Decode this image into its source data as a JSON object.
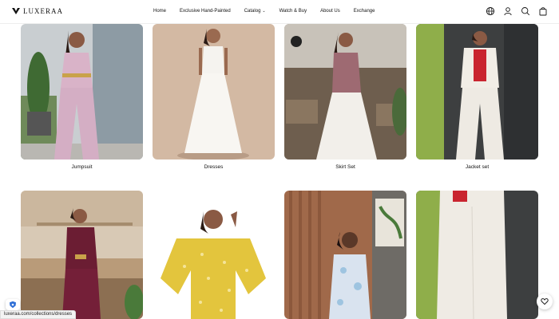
{
  "brand": {
    "name": "LUXERAA"
  },
  "nav": {
    "items": [
      {
        "label": "Home"
      },
      {
        "label": "Exclusive Hand-Painted"
      },
      {
        "label": "Catalog"
      },
      {
        "label": "Watch & Buy"
      },
      {
        "label": "About Us"
      },
      {
        "label": "Exchange"
      }
    ],
    "catalog_chevron": "⌄"
  },
  "header_icons": [
    "globe-icon",
    "account-icon",
    "search-icon",
    "bag-icon"
  ],
  "collections": [
    {
      "label": "Jumpsuit"
    },
    {
      "label": "Dresses"
    },
    {
      "label": "Skirt Set"
    },
    {
      "label": "Jacket set"
    },
    {
      "label": ""
    },
    {
      "label": ""
    },
    {
      "label": ""
    },
    {
      "label": ""
    }
  ],
  "status_bar": {
    "url": "luxeraa.com/collections/dresses"
  },
  "colors": {
    "accent": "#111111",
    "background": "#ffffff"
  }
}
